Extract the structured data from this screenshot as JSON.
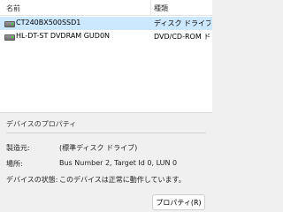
{
  "columns": {
    "name": "名前",
    "type": "種類"
  },
  "drives": [
    {
      "icon": "drive-icon",
      "name": "CT240BX500SSD1",
      "type": "ディスク ドライブ",
      "selected": true
    },
    {
      "icon": "drive-icon",
      "name": "HL-DT-ST DVDRAM GUD0N",
      "type": "DVD/CD-ROM ドライブ",
      "selected": false
    }
  ],
  "properties_panel": {
    "title": "デバイスのプロパティ",
    "rows": [
      {
        "label": "製造元:",
        "value": "(標準ディスク ドライブ)"
      },
      {
        "label": "場所:",
        "value": "Bus Number 2, Target Id 0, LUN 0"
      },
      {
        "label": "デバイスの状態:",
        "value": "このデバイスは正常に動作しています。"
      }
    ],
    "button_label": "プロパティ(R)"
  },
  "colors": {
    "selection": "#cce8ff",
    "background": "#f0f0f0"
  }
}
